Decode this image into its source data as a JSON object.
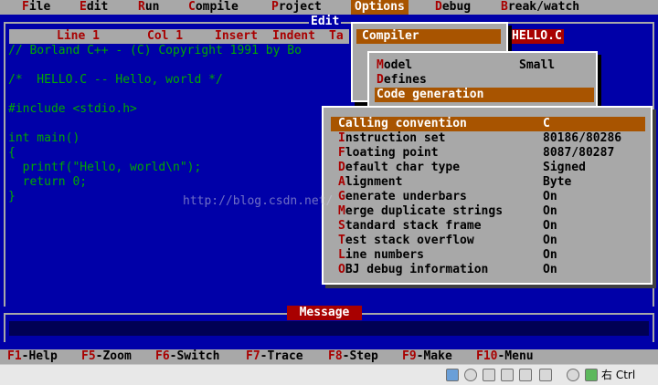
{
  "menubar": {
    "items": [
      {
        "hotkey": "F",
        "rest": "ile"
      },
      {
        "hotkey": "E",
        "rest": "dit"
      },
      {
        "hotkey": "R",
        "rest": "un"
      },
      {
        "hotkey": "C",
        "rest": "ompile"
      },
      {
        "hotkey": "P",
        "rest": "roject"
      },
      {
        "hotkey": "O",
        "rest": "ptions"
      },
      {
        "hotkey": "D",
        "rest": "ebug"
      },
      {
        "hotkey": "B",
        "rest": "reak/watch"
      }
    ]
  },
  "editor": {
    "title": "Edit",
    "status": {
      "line": "Line 1",
      "col": "Col 1",
      "insert": "Insert",
      "indent": "Indent",
      "tab": "Ta"
    },
    "filename": "HELLO.C",
    "code_lines": [
      "// Borland C++ - (C) Copyright 1991 by Bo",
      "",
      "/*  HELLO.C -- Hello, world */",
      "",
      "#include <stdio.h>",
      "",
      "int main()",
      "{",
      "  printf(\"Hello, world\\n\");",
      "  return 0;",
      "}"
    ]
  },
  "options_menu": {
    "compiler_label": "Compiler"
  },
  "compiler_submenu": {
    "items": [
      {
        "hotkey": "M",
        "rest": "odel",
        "value": "Small"
      },
      {
        "hotkey": "D",
        "rest": "efines",
        "value": ""
      },
      {
        "hotkey": "C",
        "rest": "ode generation",
        "value": ""
      }
    ]
  },
  "code_generation": {
    "items": [
      {
        "hotkey": "C",
        "rest": "alling convention",
        "value": "C"
      },
      {
        "hotkey": "I",
        "rest": "nstruction set",
        "value": "80186/80286"
      },
      {
        "hotkey": "F",
        "rest": "loating point",
        "value": "8087/80287"
      },
      {
        "hotkey": "D",
        "rest": "efault char type",
        "value": "Signed"
      },
      {
        "hotkey": "A",
        "rest": "lignment",
        "value": "Byte"
      },
      {
        "hotkey": "G",
        "rest": "enerate underbars",
        "value": "On"
      },
      {
        "hotkey": "M",
        "rest": "erge duplicate strings",
        "value": "On"
      },
      {
        "hotkey": "S",
        "rest": "tandard stack frame",
        "value": "On"
      },
      {
        "hotkey": "T",
        "rest": "est stack overflow",
        "value": "On"
      },
      {
        "hotkey": "L",
        "rest": "ine numbers",
        "value": "On"
      },
      {
        "hotkey": "O",
        "rest": "BJ debug information",
        "value": "On"
      }
    ]
  },
  "message": {
    "title": "Message"
  },
  "helpbar": {
    "items": [
      {
        "key": "F1",
        "label": "-Help"
      },
      {
        "key": "F5",
        "label": "-Zoom"
      },
      {
        "key": "F6",
        "label": "-Switch"
      },
      {
        "key": "F7",
        "label": "-Trace"
      },
      {
        "key": "F8",
        "label": "-Step"
      },
      {
        "key": "F9",
        "label": "-Make"
      },
      {
        "key": "F10",
        "label": "-Menu"
      }
    ]
  },
  "host_bar": {
    "label": "右 Ctrl"
  },
  "watermark": "http://blog.csdn.net/"
}
